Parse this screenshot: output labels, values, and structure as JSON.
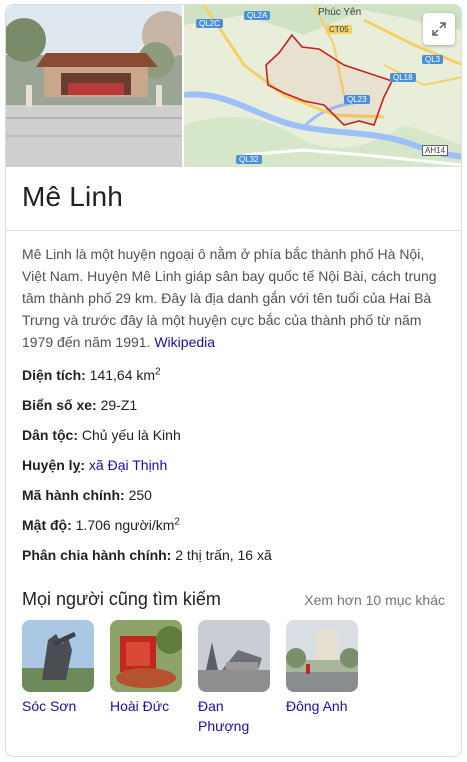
{
  "entity": {
    "title": "Mê Linh",
    "description": "Mê Linh là một huyện ngoại ô nằm ở phía bắc thành phố Hà Nội, Việt Nam. Huyện Mê Linh giáp sân bay quốc tế Nội Bài, cách trung tâm thành phố 29 km. Đây là địa danh gắn với tên tuổi của Hai Bà Trưng và trước đây là một huyện cực bắc của thành phố từ năm 1979 đến năm 1991.",
    "source_link": "Wikipedia"
  },
  "map": {
    "labels": {
      "city": "Phúc Yên",
      "ql2a": "QL2A",
      "ql2c": "QL2C",
      "ct05": "CT05",
      "ql3": "QL3",
      "ql18": "QL18",
      "ql23": "QL23",
      "ql32": "QL32",
      "ah14": "AH14"
    },
    "expand_icon": "expand-icon"
  },
  "facts": [
    {
      "key": "Diện tích:",
      "value": "141,64 km",
      "sup": "2"
    },
    {
      "key": "Biển số xe:",
      "value": "29-Z1"
    },
    {
      "key": "Dân tộc:",
      "value": "Chủ yếu là Kinh"
    },
    {
      "key": "Huyện lỵ:",
      "value": "xã Đại Thịnh",
      "link": true
    },
    {
      "key": "Mã hành chính:",
      "value": "250"
    },
    {
      "key": "Mật độ:",
      "value": "1.706 người/km",
      "sup": "2"
    },
    {
      "key": "Phân chia hành chính:",
      "value": "2 thị trấn, 16 xã"
    }
  ],
  "people_also_search": {
    "title": "Mọi người cũng tìm kiếm",
    "more": "Xem hơn 10 mục khác",
    "items": [
      {
        "label": "Sóc Sơn"
      },
      {
        "label": "Hoài Đức"
      },
      {
        "label": "Đan Phượng"
      },
      {
        "label": "Đông Anh"
      }
    ]
  },
  "colors": {
    "link": "#1a0dab",
    "body_text": "#4d5156",
    "title": "#202124",
    "muted": "#70757a",
    "border": "#dadce0",
    "map_boundary": "#c5221f"
  }
}
